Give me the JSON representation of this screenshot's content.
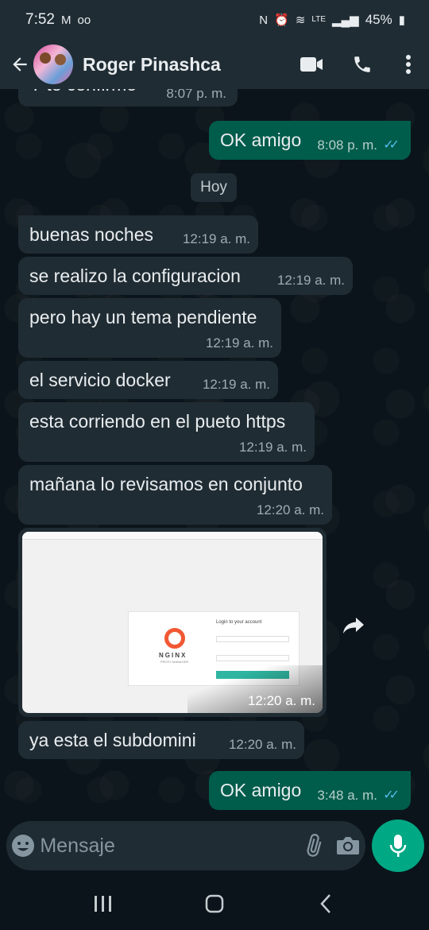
{
  "status": {
    "time": "7:52",
    "battery": "45%",
    "network": "LTE"
  },
  "header": {
    "contact_name": "Roger Pinashca"
  },
  "chat": {
    "partial_message": {
      "text": "Y te confirmo",
      "time": "8:07 p. m."
    },
    "messages": [
      {
        "dir": "out",
        "text": "OK amigo",
        "time": "8:08 p. m.",
        "read": true
      },
      {
        "dir": "in",
        "text": "buenas noches",
        "time": "12:19 a. m."
      },
      {
        "dir": "in",
        "text": "se realizo la configuracion",
        "time": "12:19 a. m."
      },
      {
        "dir": "in",
        "text": "pero hay un tema pendiente",
        "time": "12:19 a. m."
      },
      {
        "dir": "in",
        "text": "el servicio docker",
        "time": "12:19 a. m."
      },
      {
        "dir": "in",
        "text": "esta corriendo en el pueto https",
        "time": "12:19 a. m."
      },
      {
        "dir": "in",
        "text": "mañana lo revisamos en conjunto",
        "time": "12:20 a. m."
      },
      {
        "dir": "in",
        "text": "ya esta el subdomini",
        "time": "12:20 a. m."
      },
      {
        "dir": "out",
        "text": "OK amigo",
        "time": "3:48 a. m.",
        "read": true
      }
    ],
    "day_separator": "Hoy",
    "image_message": {
      "time": "12:20 a. m.",
      "preview": {
        "logo_text": "NGINX",
        "logo_subtext": "PROXY MANAGER",
        "form_title": "Login to your account"
      }
    }
  },
  "composer": {
    "placeholder": "Mensaje"
  },
  "icons": {
    "back": "arrow-left-icon",
    "video": "video-camera-icon",
    "call": "phone-icon",
    "menu": "more-vertical-icon",
    "emoji": "emoji-icon",
    "attach": "paperclip-icon",
    "camera": "camera-icon",
    "mic": "microphone-icon",
    "forward": "forward-icon"
  },
  "colors": {
    "background": "#0b141a",
    "incoming_bubble": "#202c33",
    "outgoing_bubble": "#005c4b",
    "header": "#1f2c34",
    "accent": "#00a884",
    "read_ticks": "#53bdeb"
  }
}
